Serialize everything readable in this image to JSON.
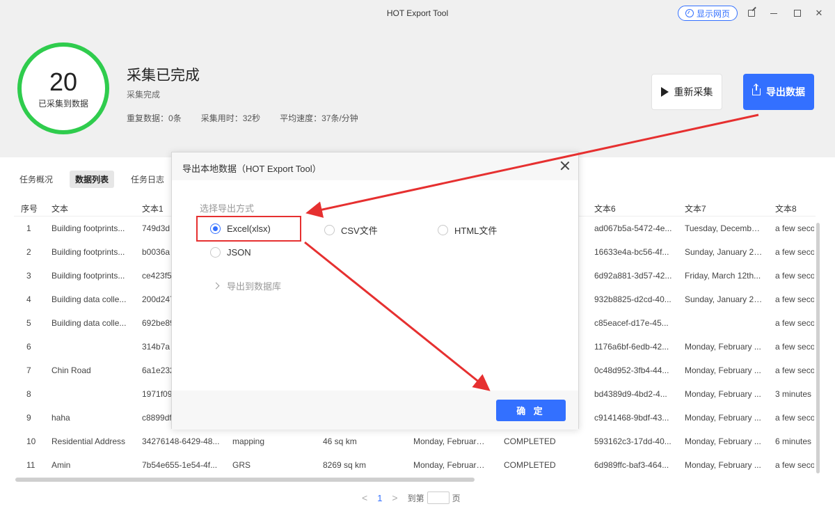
{
  "window": {
    "title": "HOT Export Tool",
    "show_web_label": "显示网页"
  },
  "progress": {
    "count": "20",
    "count_label": "已采集到数据",
    "ring_color": "#2fcc4d"
  },
  "status": {
    "title": "采集已完成",
    "subtitle": "采集完成",
    "stats": [
      {
        "label": "重复数据：",
        "value": "0条"
      },
      {
        "label": "采集用时：",
        "value": "32秒"
      },
      {
        "label": "平均速度：",
        "value": "37条/分钟"
      }
    ]
  },
  "actions": {
    "recollect_label": "重新采集",
    "export_label": "导出数据",
    "accent": "#3370ff"
  },
  "tabs": [
    {
      "label": "任务概况"
    },
    {
      "label": "数据列表"
    },
    {
      "label": "任务日志"
    }
  ],
  "table": {
    "headers": [
      "序号",
      "文本",
      "文本1",
      "",
      "",
      "",
      "",
      "文本6",
      "文本7",
      "文本8"
    ],
    "rows": [
      [
        "1",
        "Building footprints...",
        "749d3d",
        "",
        "",
        "",
        "",
        "ad067b5a-5472-4e...",
        "Tuesday, Decembe...",
        "a few seco"
      ],
      [
        "2",
        "Building footprints...",
        "b0036a",
        "",
        "",
        "",
        "",
        "16633e4a-bc56-4f...",
        "Sunday, January 23...",
        "a few seco"
      ],
      [
        "3",
        "Building footprints...",
        "ce423f5",
        "",
        "",
        "",
        "",
        "6d92a881-3d57-42...",
        "Friday, March 12th...",
        "a few seco"
      ],
      [
        "4",
        "Building data colle...",
        "200d247",
        "",
        "",
        "",
        "",
        "932b8825-d2cd-40...",
        "Sunday, January 23...",
        "a few seco"
      ],
      [
        "5",
        "Building data colle...",
        "692be89",
        "",
        "",
        "",
        "",
        "c85eacef-d17e-45...",
        "",
        "a few seco"
      ],
      [
        "6",
        "",
        "314b7a",
        "",
        "",
        "",
        "",
        "1176a6bf-6edb-42...",
        "Monday, February ...",
        "a few seco"
      ],
      [
        "7",
        "Chin Road",
        "6a1e232",
        "",
        "",
        "",
        "",
        "0c48d952-3fb4-44...",
        "Monday, February ...",
        "a few seco"
      ],
      [
        "8",
        "",
        "1971f09",
        "",
        "",
        "",
        "",
        "bd4389d9-4bd2-4...",
        "Monday, February ...",
        "3 minutes"
      ],
      [
        "9",
        "haha",
        "c8899df",
        "",
        "",
        "",
        "",
        "c9141468-9bdf-43...",
        "Monday, February ...",
        "a few seco"
      ],
      [
        "10",
        "Residential Address",
        "34276148-6429-48...",
        "mapping",
        "46 sq km",
        "Monday, February ...",
        "COMPLETED",
        "593162c3-17dd-40...",
        "Monday, February ...",
        "6 minutes"
      ],
      [
        "11",
        "Amin",
        "7b54e655-1e54-4f...",
        "GRS",
        "8269 sq km",
        "Monday, February ...",
        "COMPLETED",
        "6d989ffc-baf3-464...",
        "Monday, February ...",
        "a few seco"
      ]
    ]
  },
  "pagination": {
    "prev": "<",
    "current": "1",
    "next": ">",
    "goto_prefix": "到第",
    "goto_suffix": "页"
  },
  "dialog": {
    "title": "导出本地数据（HOT Export Tool）",
    "section_label": "选择导出方式",
    "options": [
      {
        "label": "Excel(xlsx)",
        "checked": true
      },
      {
        "label": "CSV文件",
        "checked": false
      },
      {
        "label": "HTML文件",
        "checked": false
      },
      {
        "label": "JSON",
        "checked": false
      }
    ],
    "db_label": "导出到数据库",
    "confirm_label": "确 定",
    "highlight_color": "#e63030"
  }
}
